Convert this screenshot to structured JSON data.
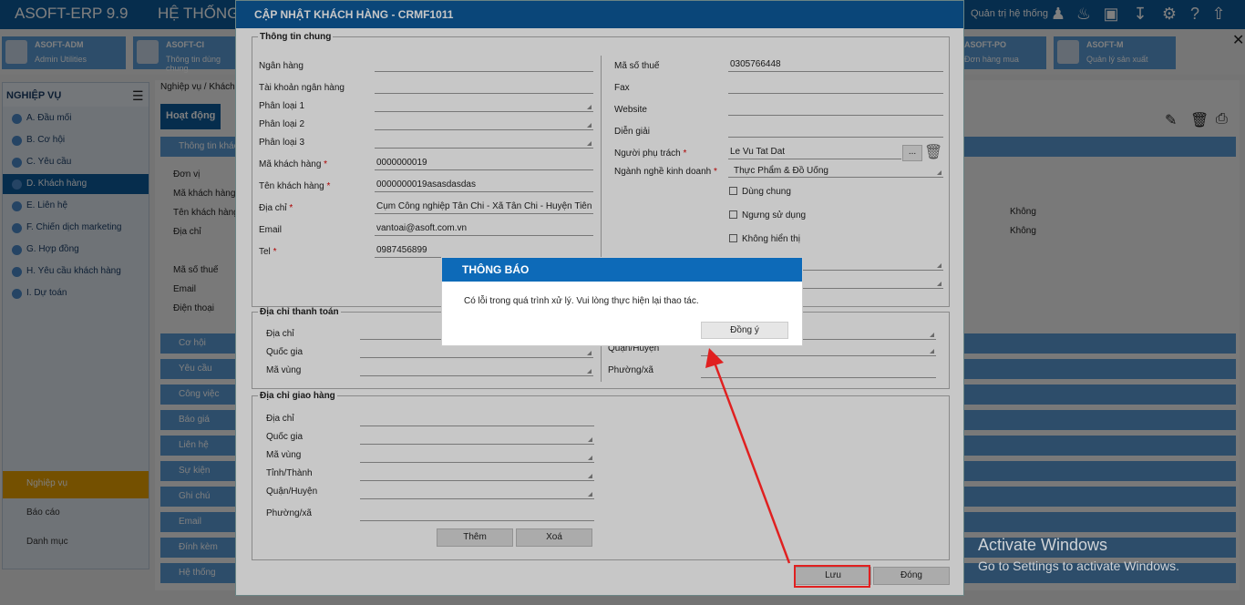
{
  "app": {
    "title": "ASOFT-ERP 9.9",
    "system_menu": "HỆ THỐNG",
    "user_label": "Quản trị hệ thống"
  },
  "modules": [
    {
      "name": "ASOFT-ADM",
      "desc": "Admin Utilities"
    },
    {
      "name": "ASOFT-CI",
      "desc": "Thông tin dùng chung"
    },
    {
      "name": "ASOFT-PO",
      "desc": "Đơn hàng mua"
    },
    {
      "name": "ASOFT-M",
      "desc": "Quản lý sản xuất"
    }
  ],
  "sidebar": {
    "header": "NGHIỆP VỤ",
    "items": [
      {
        "label": "A. Đầu mối"
      },
      {
        "label": "B. Cơ hội"
      },
      {
        "label": "C. Yêu cầu"
      },
      {
        "label": "D. Khách hàng"
      },
      {
        "label": "E. Liên hệ"
      },
      {
        "label": "F. Chiến dịch marketing"
      },
      {
        "label": "G. Hợp đồng"
      },
      {
        "label": "H. Yêu cầu khách hàng"
      },
      {
        "label": "I. Dự toán"
      }
    ],
    "bottom": [
      {
        "label": "Nghiệp vụ"
      },
      {
        "label": "Báo cáo"
      },
      {
        "label": "Danh mục"
      }
    ]
  },
  "main": {
    "breadcrumb": "Nghiệp vụ / Khách",
    "activity_tab": "Hoạt động",
    "info_header": "Thông tin khách",
    "info_labels": [
      "Đơn vị",
      "Mã khách hàng",
      "Tên khách hàng",
      "Địa chỉ",
      "Mã số thuế",
      "Email",
      "Điện thoại"
    ],
    "info_values": [
      "Không",
      "Không"
    ],
    "sections": [
      "Cơ hội",
      "Yêu cầu",
      "Công việc",
      "Báo giá",
      "Liên hệ",
      "Sự kiện",
      "Ghi chú",
      "Email",
      "Đính kèm",
      "Hệ thống"
    ]
  },
  "dialog": {
    "title": "CẬP NHẬT KHÁCH HÀNG - CRMF1011",
    "general_legend": "Thông tin chung",
    "left_fields": [
      {
        "label": "Ngân hàng",
        "value": ""
      },
      {
        "label": "Tài khoản ngân hàng",
        "value": ""
      },
      {
        "label": "Phân loại 1",
        "value": ""
      },
      {
        "label": "Phân loại 2",
        "value": ""
      },
      {
        "label": "Phân loại 3",
        "value": ""
      },
      {
        "label": "Mã khách hàng",
        "value": "0000000019"
      },
      {
        "label": "Tên khách hàng",
        "value": "0000000019asasdasdas"
      },
      {
        "label": "Địa chỉ",
        "value": "Cụm Công nghiệp Tân Chi - Xã Tân Chi - Huyện Tiên D"
      },
      {
        "label": "Email",
        "value": "vantoai@asoft.com.vn"
      },
      {
        "label": "Tel",
        "value": "0987456899"
      }
    ],
    "right_fields": [
      {
        "label": "Mã số thuế",
        "value": "0305766448"
      },
      {
        "label": "Fax",
        "value": ""
      },
      {
        "label": "Website",
        "value": ""
      },
      {
        "label": "Diễn giải",
        "value": ""
      },
      {
        "label": "Người phụ trách",
        "value": "Le Vu Tat Dat"
      },
      {
        "label": "Ngành nghề kinh doanh",
        "value": "Thực Phẩm & Đồ Uống"
      }
    ],
    "ellipsis": "...",
    "checkboxes": [
      "Dùng chung",
      "Ngưng sử dụng",
      "Không hiển thị"
    ],
    "billing_legend": "Địa chỉ thanh toán",
    "billing_fields": [
      "Địa chỉ",
      "Quốc gia",
      "Mã vùng"
    ],
    "billing_right": [
      "Quận/Huyện",
      "Phường/xã"
    ],
    "shipping_legend": "Địa chỉ giao hàng",
    "shipping_fields": [
      "Địa chỉ",
      "Quốc gia",
      "Mã vùng",
      "Tỉnh/Thành",
      "Quận/Huyện",
      "Phường/xã"
    ],
    "add_label": "Thêm",
    "delete_label": "Xoá",
    "save_label": "Lưu",
    "close_label": "Đóng"
  },
  "alert": {
    "title": "THÔNG BÁO",
    "message": "Có lỗi trong quá trình xử lý. Vui lòng thực hiện lại thao tác.",
    "ok_label": "Đồng ý"
  },
  "watermark": {
    "line1": "Activate Windows",
    "line2": "Go to Settings to activate Windows."
  },
  "colors": {
    "brand": "#0d5a9b",
    "annotation": "#e02020"
  }
}
